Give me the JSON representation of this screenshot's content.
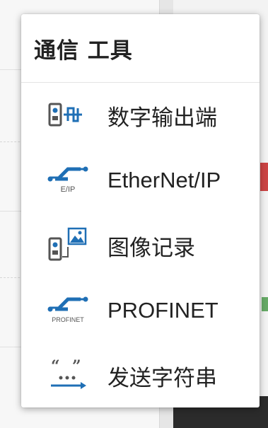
{
  "popup": {
    "title": "通信 工具",
    "items": [
      {
        "label": "数字输出端",
        "icon": "digital-output-icon"
      },
      {
        "label": "EtherNet/IP",
        "icon": "ethernet-ip-icon",
        "icon_caption": "E/IP"
      },
      {
        "label": "图像记录",
        "icon": "image-record-icon"
      },
      {
        "label": "PROFINET",
        "icon": "profinet-icon",
        "icon_caption": "PROFINET"
      },
      {
        "label": "发送字符串",
        "icon": "send-string-icon"
      }
    ]
  },
  "colors": {
    "accent": "#1f6fb5",
    "icon_gray": "#555555"
  }
}
